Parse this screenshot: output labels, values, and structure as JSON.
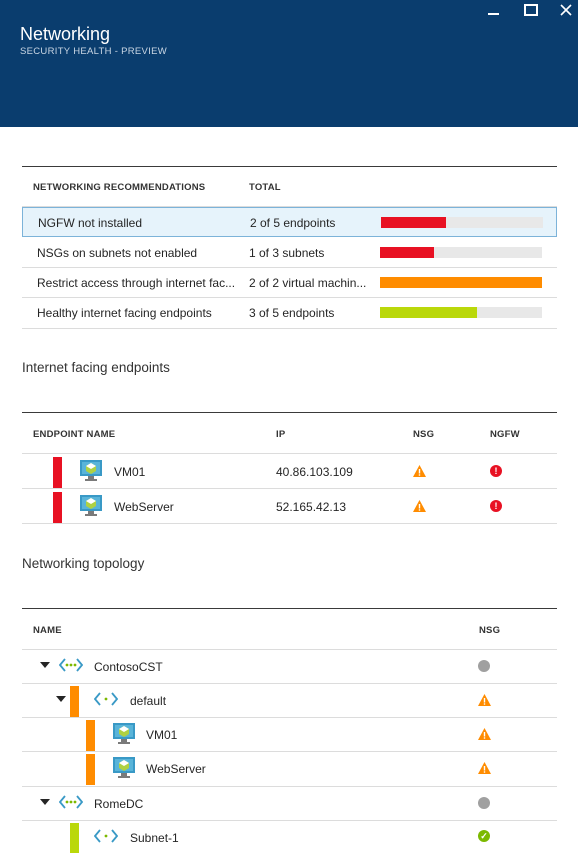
{
  "header": {
    "title": "Networking",
    "subtitle": "SECURITY HEALTH - PREVIEW",
    "minimize": "▬",
    "maximize": "☐",
    "close": "✕"
  },
  "recommendations": {
    "col_name": "NETWORKING RECOMMENDATIONS",
    "col_total": "TOTAL",
    "rows": [
      {
        "name": "NGFW not installed",
        "total": "2 of 5 endpoints",
        "color": "#e81123",
        "fraction": 0.4
      },
      {
        "name": "NSGs on subnets not enabled",
        "total": "1 of 3 subnets",
        "color": "#e81123",
        "fraction": 0.333
      },
      {
        "name": "Restrict access through internet fac...",
        "total": "2 of 2 virtual machin...",
        "color": "#ff8c00",
        "fraction": 1.0
      },
      {
        "name": "Healthy internet facing endpoints",
        "total": "3 of 5 endpoints",
        "color": "#bad80a",
        "fraction": 0.6
      }
    ]
  },
  "endpoints": {
    "section_title": "Internet facing endpoints",
    "col_name": "ENDPOINT NAME",
    "col_ip": "IP",
    "col_nsg": "NSG",
    "col_ngfw": "NGFW",
    "rows": [
      {
        "name": "VM01",
        "ip": "40.86.103.109"
      },
      {
        "name": "WebServer",
        "ip": "52.165.42.13"
      }
    ]
  },
  "topology": {
    "section_title": "Networking topology",
    "col_name": "NAME",
    "col_nsg": "NSG",
    "rows": [
      {
        "name": "ContosoCST",
        "icon": "vnet-icon",
        "nsg": "none"
      },
      {
        "name": "default",
        "icon": "subnet-icon",
        "nsg": "warning"
      },
      {
        "name": "VM01",
        "icon": "vm-icon",
        "nsg": "warning"
      },
      {
        "name": "WebServer",
        "icon": "vm-icon",
        "nsg": "warning"
      },
      {
        "name": "RomeDC",
        "icon": "vnet-icon",
        "nsg": "none"
      },
      {
        "name": "Subnet-1",
        "icon": "subnet-icon",
        "nsg": "ok"
      }
    ]
  },
  "colors": {
    "header_bg": "#0a3d6e",
    "critical": "#e81123",
    "warning": "#ff8c00",
    "healthy": "#bad80a",
    "ok": "#7cb900"
  }
}
